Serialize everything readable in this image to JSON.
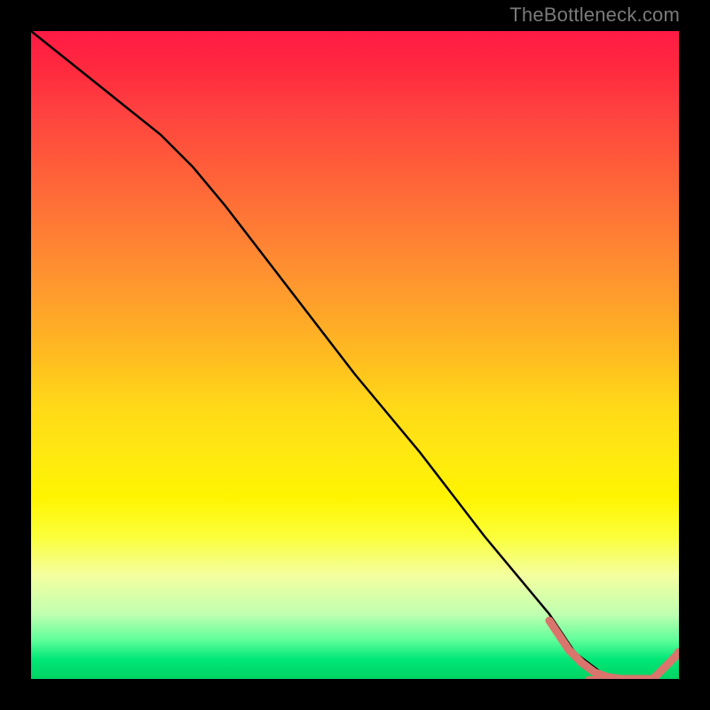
{
  "watermark": "TheBottleneck.com",
  "colors": {
    "line": "#000000",
    "points": "#d9756c",
    "dash_line": "#d9756c"
  },
  "chart_data": {
    "type": "line",
    "title": "",
    "xlabel": "",
    "ylabel": "",
    "xlim": [
      0,
      100
    ],
    "ylim": [
      0,
      100
    ],
    "series": [
      {
        "name": "curve",
        "x": [
          0,
          10,
          20,
          25,
          30,
          40,
          50,
          60,
          70,
          80,
          84,
          88,
          92,
          96,
          100
        ],
        "y": [
          100,
          92,
          84,
          79,
          73,
          60,
          47,
          35,
          22,
          10,
          4,
          1,
          0,
          0,
          4
        ]
      }
    ],
    "highlight_segment": {
      "x": [
        80,
        83,
        85,
        87,
        89,
        91,
        94,
        96,
        100
      ],
      "y": [
        9,
        4.5,
        2.5,
        1,
        0.3,
        0,
        0,
        0,
        4
      ]
    },
    "dash_segment": {
      "x_start": 86,
      "x_end": 96,
      "y": 0
    }
  }
}
